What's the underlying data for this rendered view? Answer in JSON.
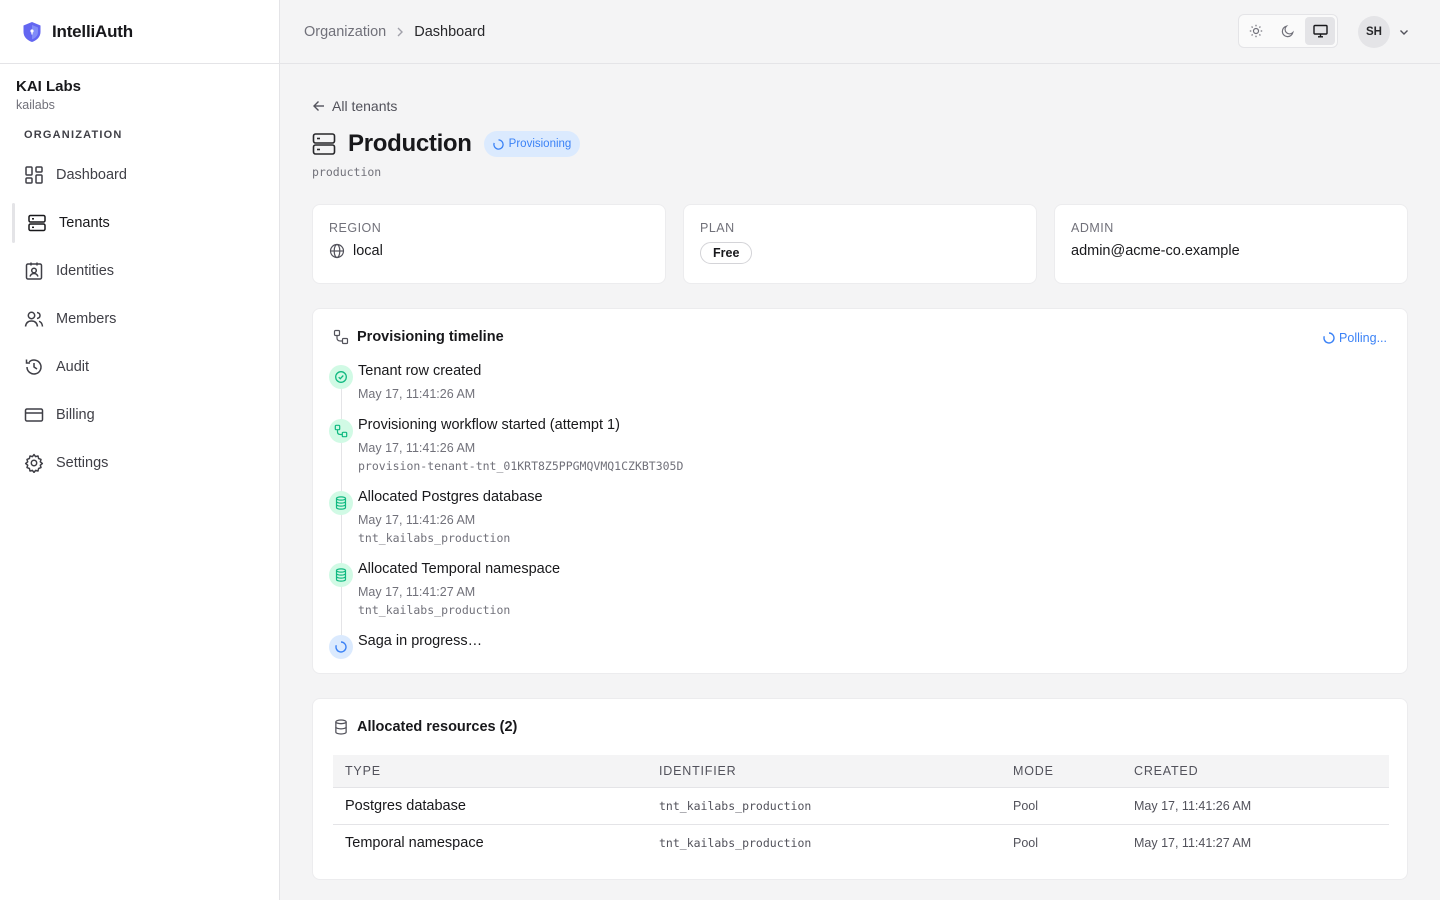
{
  "app": {
    "name": "IntelliAuth"
  },
  "org": {
    "name": "KAI Labs",
    "slug": "kailabs"
  },
  "sidebar": {
    "section_label": "ORGANIZATION",
    "items": [
      {
        "label": "Dashboard",
        "icon": "dashboard-icon"
      },
      {
        "label": "Tenants",
        "icon": "server-icon",
        "active": true
      },
      {
        "label": "Identities",
        "icon": "id-badge-icon"
      },
      {
        "label": "Members",
        "icon": "users-icon"
      },
      {
        "label": "Audit",
        "icon": "history-icon"
      },
      {
        "label": "Billing",
        "icon": "credit-card-icon"
      },
      {
        "label": "Settings",
        "icon": "gear-icon"
      }
    ]
  },
  "header": {
    "breadcrumb": [
      "Organization",
      "Dashboard"
    ],
    "theme_options": [
      "light",
      "dark",
      "system"
    ],
    "theme_selected": "system",
    "user_initials": "SH"
  },
  "tenant": {
    "back_label": "All tenants",
    "name": "Production",
    "status": "Provisioning",
    "slug": "production",
    "region_label": "REGION",
    "region": "local",
    "plan_label": "PLAN",
    "plan": "Free",
    "admin_label": "ADMIN",
    "admin": "admin@acme-co.example"
  },
  "timeline": {
    "title": "Provisioning timeline",
    "polling": "Polling...",
    "events": [
      {
        "title": "Tenant row created",
        "time": "May 17, 11:41:26 AM",
        "meta": "",
        "icon": "check-circle-icon"
      },
      {
        "title": "Provisioning workflow started (attempt 1)",
        "time": "May 17, 11:41:26 AM",
        "meta": "provision-tenant-tnt_01KRT8Z5PPGMQVMQ1CZKBT305D",
        "icon": "workflow-icon"
      },
      {
        "title": "Allocated Postgres database",
        "time": "May 17, 11:41:26 AM",
        "meta": "tnt_kailabs_production",
        "icon": "database-icon"
      },
      {
        "title": "Allocated Temporal namespace",
        "time": "May 17, 11:41:27 AM",
        "meta": "tnt_kailabs_production",
        "icon": "database-icon"
      },
      {
        "title": "Saga in progress…",
        "time": "",
        "meta": "",
        "icon": "spinner-icon"
      }
    ]
  },
  "resources": {
    "title": "Allocated resources (2)",
    "columns": [
      "TYPE",
      "IDENTIFIER",
      "MODE",
      "CREATED"
    ],
    "rows": [
      [
        "Postgres database",
        "tnt_kailabs_production",
        "Pool",
        "May 17, 11:41:26 AM"
      ],
      [
        "Temporal namespace",
        "tnt_kailabs_production",
        "Pool",
        "May 17, 11:41:27 AM"
      ]
    ]
  },
  "colors": {
    "accent": "#3b82f6",
    "success": "#10b981",
    "brand": "#6366f1"
  }
}
